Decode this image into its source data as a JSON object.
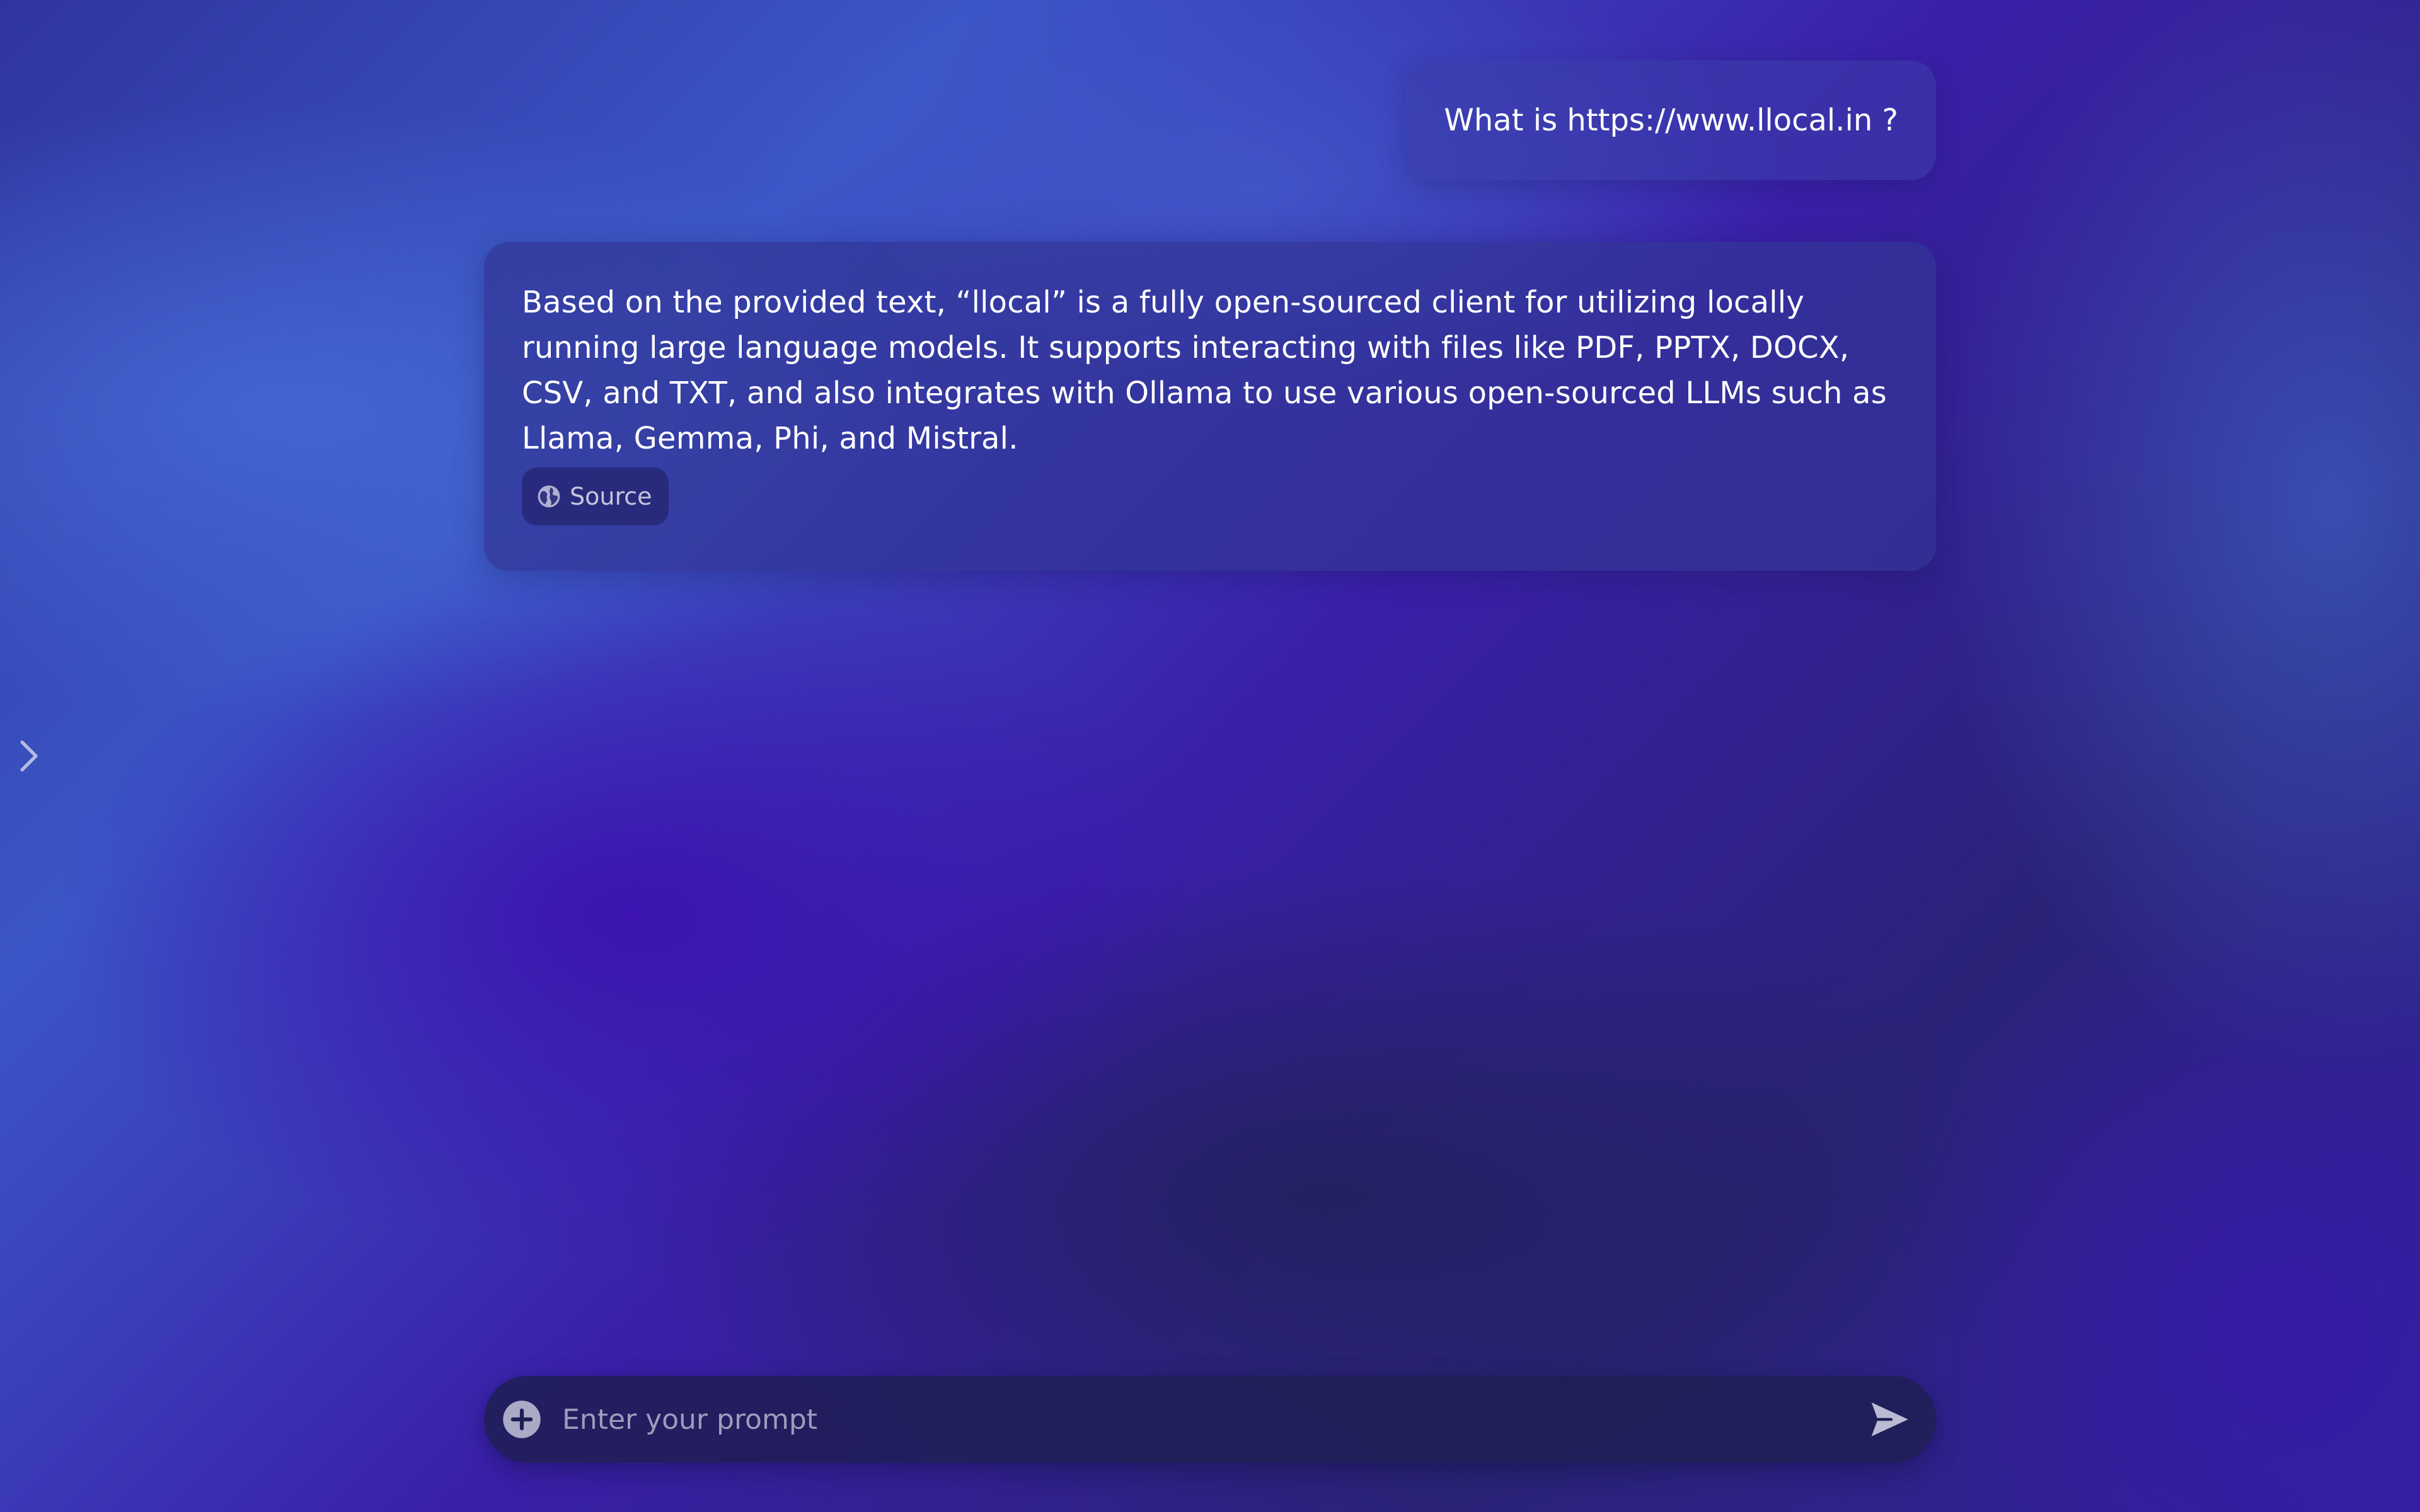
{
  "conversation": {
    "user_message": "What is https://www.llocal.in ?",
    "assistant_message": "Based on the provided text, “llocal” is a fully open-sourced client for utilizing locally running large language models. It supports interacting with files like PDF, PPTX, DOCX, CSV, and TXT, and also integrates with Ollama to use various open-sourced LLMs such as Llama, Gemma, Phi, and Mistral.",
    "source_label": "Source",
    "source_icon": "globe-icon"
  },
  "sidebar": {
    "toggle_icon": "chevron-right-icon"
  },
  "prompt": {
    "placeholder": "Enter your prompt",
    "value": "",
    "attach_icon": "plus-circle-icon",
    "send_icon": "send-icon"
  },
  "colors": {
    "bubble_user": "#3a3caa",
    "bubble_assistant": "#323496",
    "prompt_bar": "#1e1e54",
    "text": "#ffffff",
    "placeholder": "#cdcde1"
  }
}
